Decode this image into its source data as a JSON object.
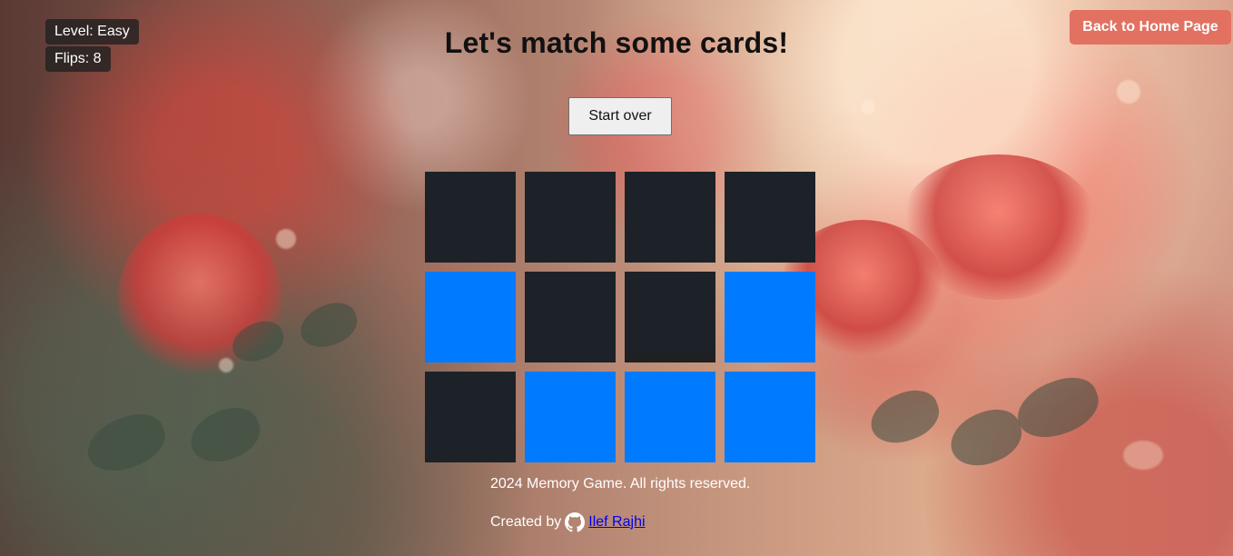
{
  "status": {
    "level": "Level: Easy",
    "flips": "Flips: 8"
  },
  "header": {
    "title": "Let's match some cards!"
  },
  "actions": {
    "back_home": "Back to Home Page",
    "start_over": "Start over"
  },
  "board": {
    "cards": [
      {
        "state": "revealed",
        "image": "white-tulip"
      },
      {
        "state": "revealed",
        "image": "pink-lotus-hand"
      },
      {
        "state": "revealed",
        "image": "pink-lotus-hand"
      },
      {
        "state": "revealed",
        "image": "cupped-lotus"
      },
      {
        "state": "hidden"
      },
      {
        "state": "revealed",
        "image": "cupped-lotus-alt"
      },
      {
        "state": "revealed",
        "image": "pink-lotus-green"
      },
      {
        "state": "hidden"
      },
      {
        "state": "revealed",
        "image": "white-tulip"
      },
      {
        "state": "hidden"
      },
      {
        "state": "hidden"
      },
      {
        "state": "hidden"
      }
    ]
  },
  "footer": {
    "rights": "2024 Memory Game. All rights reserved.",
    "created_by": "Created by",
    "author": "Ilef Rajhi"
  },
  "colors": {
    "card_back": "#007bff",
    "home_button": "#e27161"
  },
  "icons": {
    "github": "github-icon"
  }
}
